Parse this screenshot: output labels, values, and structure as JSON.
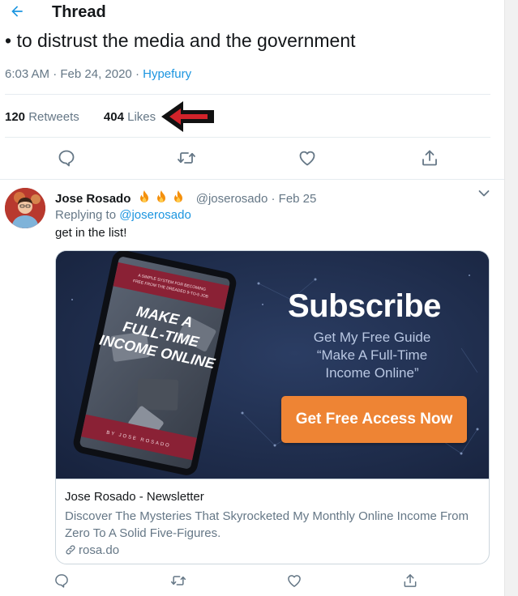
{
  "header": {
    "title": "Thread",
    "back_icon": "arrow-left-icon"
  },
  "tweet": {
    "text": "• to distrust the media and the government",
    "time": "6:03 AM · Feb 24, 2020",
    "separator": "·",
    "source": "Hypefury",
    "retweets_count": "120",
    "retweets_label": "Retweets",
    "likes_count": "404",
    "likes_label": "Likes"
  },
  "actions": [
    "reply-icon",
    "retweet-icon",
    "like-icon",
    "share-icon"
  ],
  "reply": {
    "name": "Jose Rosado",
    "emoji": "🔥🔥🔥",
    "handle": "@joserosado",
    "dot": "·",
    "date": "Feb 25",
    "replying_prefix": "Replying to",
    "replying_handle": "@joserosado",
    "text": "get in the list!",
    "card": {
      "banner_headline": "Subscribe",
      "banner_line1": "Get My Free Guide",
      "banner_line2": "“Make A Full-Time",
      "banner_line3": "Income Online”",
      "cta_label": "Get Free Access Now",
      "book_title": "MAKE A FULL-TIME INCOME ONLINE",
      "book_kicker": "A SIMPLE SYSTEM FOR BECOMING FREE FROM THE DREADED 9-TO-5 JOB",
      "book_author": "BY JOSE ROSADO",
      "title": "Jose Rosado - Newsletter",
      "description": "Discover The Mysteries That Skyrocketed My Monthly Online Income From Zero To A Solid Five-Figures.",
      "link": "rosa.do"
    }
  },
  "colors": {
    "accent": "#1b95e0",
    "text": "#14171a",
    "muted": "#657786",
    "banner": "#1f2e4f",
    "cta": "#ee8434",
    "book_red": "#8a2135"
  }
}
